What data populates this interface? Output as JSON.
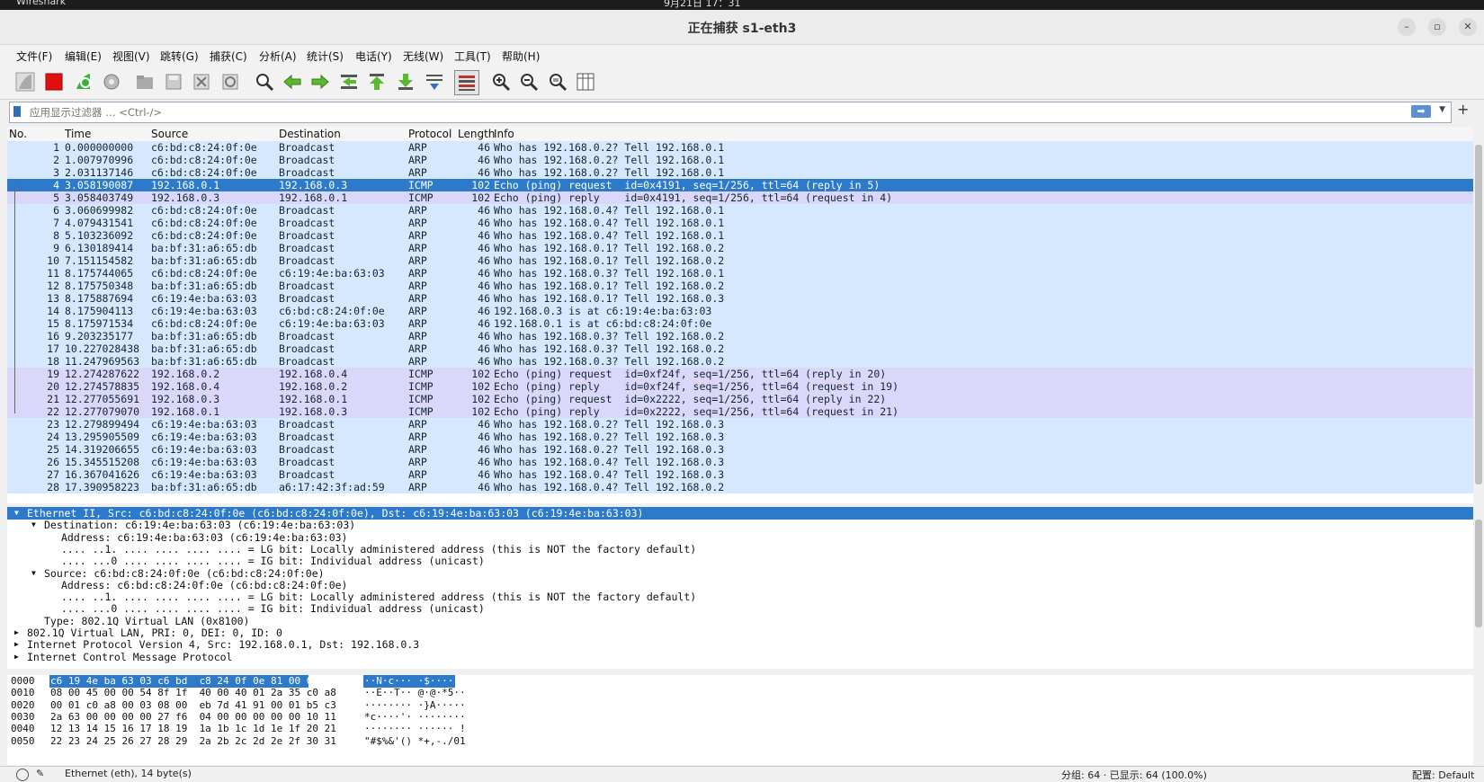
{
  "system": {
    "app_name": "Wireshark",
    "clock": "9月21日 17：31"
  },
  "window": {
    "title": "正在捕获 s1-eth3",
    "minimize": "–",
    "restore": "▫",
    "close": "✕"
  },
  "menu": [
    "文件(F)",
    "编辑(E)",
    "视图(V)",
    "跳转(G)",
    "捕获(C)",
    "分析(A)",
    "统计(S)",
    "电话(Y)",
    "无线(W)",
    "工具(T)",
    "帮助(H)"
  ],
  "toolbar_icons": [
    "shark-fin-start-icon",
    "stop-capture-icon",
    "restart-capture-icon",
    "capture-options-icon",
    "open-file-icon",
    "save-file-icon",
    "close-file-icon",
    "reload-file-icon",
    "find-packet-icon",
    "go-back-icon",
    "go-forward-icon",
    "go-to-packet-icon",
    "go-first-icon",
    "go-last-icon",
    "auto-scroll-icon",
    "colorize-icon",
    "zoom-in-icon",
    "zoom-out-icon",
    "normal-size-icon",
    "resize-columns-icon"
  ],
  "filter": {
    "placeholder": "应用显示过滤器 … <Ctrl-/>",
    "apply_label": "➡",
    "add_label": "+"
  },
  "packet_list": {
    "columns": [
      "No.",
      "Time",
      "Source",
      "Destination",
      "Protocol",
      "Length",
      "Info"
    ],
    "rows": [
      {
        "no": "1",
        "time": "0.000000000",
        "src": "c6:bd:c8:24:0f:0e",
        "dst": "Broadcast",
        "proto": "ARP",
        "len": "46",
        "info": "Who has 192.168.0.2? Tell 192.168.0.1",
        "type": "arp"
      },
      {
        "no": "2",
        "time": "1.007970996",
        "src": "c6:bd:c8:24:0f:0e",
        "dst": "Broadcast",
        "proto": "ARP",
        "len": "46",
        "info": "Who has 192.168.0.2? Tell 192.168.0.1",
        "type": "arp"
      },
      {
        "no": "3",
        "time": "2.031137146",
        "src": "c6:bd:c8:24:0f:0e",
        "dst": "Broadcast",
        "proto": "ARP",
        "len": "46",
        "info": "Who has 192.168.0.2? Tell 192.168.0.1",
        "type": "arp"
      },
      {
        "no": "4",
        "time": "3.058190087",
        "src": "192.168.0.1",
        "dst": "192.168.0.3",
        "proto": "ICMP",
        "len": "102",
        "info": "Echo (ping) request  id=0x4191, seq=1/256, ttl=64 (reply in 5)",
        "type": "sel"
      },
      {
        "no": "5",
        "time": "3.058403749",
        "src": "192.168.0.3",
        "dst": "192.168.0.1",
        "proto": "ICMP",
        "len": "102",
        "info": "Echo (ping) reply    id=0x4191, seq=1/256, ttl=64 (request in 4)",
        "type": "icmp"
      },
      {
        "no": "6",
        "time": "3.060699982",
        "src": "c6:bd:c8:24:0f:0e",
        "dst": "Broadcast",
        "proto": "ARP",
        "len": "46",
        "info": "Who has 192.168.0.4? Tell 192.168.0.1",
        "type": "arp"
      },
      {
        "no": "7",
        "time": "4.079431541",
        "src": "c6:bd:c8:24:0f:0e",
        "dst": "Broadcast",
        "proto": "ARP",
        "len": "46",
        "info": "Who has 192.168.0.4? Tell 192.168.0.1",
        "type": "arp"
      },
      {
        "no": "8",
        "time": "5.103236092",
        "src": "c6:bd:c8:24:0f:0e",
        "dst": "Broadcast",
        "proto": "ARP",
        "len": "46",
        "info": "Who has 192.168.0.4? Tell 192.168.0.1",
        "type": "arp"
      },
      {
        "no": "9",
        "time": "6.130189414",
        "src": "ba:bf:31:a6:65:db",
        "dst": "Broadcast",
        "proto": "ARP",
        "len": "46",
        "info": "Who has 192.168.0.1? Tell 192.168.0.2",
        "type": "arp"
      },
      {
        "no": "10",
        "time": "7.151154582",
        "src": "ba:bf:31:a6:65:db",
        "dst": "Broadcast",
        "proto": "ARP",
        "len": "46",
        "info": "Who has 192.168.0.1? Tell 192.168.0.2",
        "type": "arp"
      },
      {
        "no": "11",
        "time": "8.175744065",
        "src": "c6:bd:c8:24:0f:0e",
        "dst": "c6:19:4e:ba:63:03",
        "proto": "ARP",
        "len": "46",
        "info": "Who has 192.168.0.3? Tell 192.168.0.1",
        "type": "arp"
      },
      {
        "no": "12",
        "time": "8.175750348",
        "src": "ba:bf:31:a6:65:db",
        "dst": "Broadcast",
        "proto": "ARP",
        "len": "46",
        "info": "Who has 192.168.0.1? Tell 192.168.0.2",
        "type": "arp"
      },
      {
        "no": "13",
        "time": "8.175887694",
        "src": "c6:19:4e:ba:63:03",
        "dst": "Broadcast",
        "proto": "ARP",
        "len": "46",
        "info": "Who has 192.168.0.1? Tell 192.168.0.3",
        "type": "arp"
      },
      {
        "no": "14",
        "time": "8.175904113",
        "src": "c6:19:4e:ba:63:03",
        "dst": "c6:bd:c8:24:0f:0e",
        "proto": "ARP",
        "len": "46",
        "info": "192.168.0.3 is at c6:19:4e:ba:63:03",
        "type": "arp"
      },
      {
        "no": "15",
        "time": "8.175971534",
        "src": "c6:bd:c8:24:0f:0e",
        "dst": "c6:19:4e:ba:63:03",
        "proto": "ARP",
        "len": "46",
        "info": "192.168.0.1 is at c6:bd:c8:24:0f:0e",
        "type": "arp"
      },
      {
        "no": "16",
        "time": "9.203235177",
        "src": "ba:bf:31:a6:65:db",
        "dst": "Broadcast",
        "proto": "ARP",
        "len": "46",
        "info": "Who has 192.168.0.3? Tell 192.168.0.2",
        "type": "arp"
      },
      {
        "no": "17",
        "time": "10.227028438",
        "src": "ba:bf:31:a6:65:db",
        "dst": "Broadcast",
        "proto": "ARP",
        "len": "46",
        "info": "Who has 192.168.0.3? Tell 192.168.0.2",
        "type": "arp"
      },
      {
        "no": "18",
        "time": "11.247969563",
        "src": "ba:bf:31:a6:65:db",
        "dst": "Broadcast",
        "proto": "ARP",
        "len": "46",
        "info": "Who has 192.168.0.3? Tell 192.168.0.2",
        "type": "arp"
      },
      {
        "no": "19",
        "time": "12.274287622",
        "src": "192.168.0.2",
        "dst": "192.168.0.4",
        "proto": "ICMP",
        "len": "102",
        "info": "Echo (ping) request  id=0xf24f, seq=1/256, ttl=64 (reply in 20)",
        "type": "icmp"
      },
      {
        "no": "20",
        "time": "12.274578835",
        "src": "192.168.0.4",
        "dst": "192.168.0.2",
        "proto": "ICMP",
        "len": "102",
        "info": "Echo (ping) reply    id=0xf24f, seq=1/256, ttl=64 (request in 19)",
        "type": "icmp"
      },
      {
        "no": "21",
        "time": "12.277055691",
        "src": "192.168.0.3",
        "dst": "192.168.0.1",
        "proto": "ICMP",
        "len": "102",
        "info": "Echo (ping) request  id=0x2222, seq=1/256, ttl=64 (reply in 22)",
        "type": "icmp"
      },
      {
        "no": "22",
        "time": "12.277079070",
        "src": "192.168.0.1",
        "dst": "192.168.0.3",
        "proto": "ICMP",
        "len": "102",
        "info": "Echo (ping) reply    id=0x2222, seq=1/256, ttl=64 (request in 21)",
        "type": "icmp"
      },
      {
        "no": "23",
        "time": "12.279899494",
        "src": "c6:19:4e:ba:63:03",
        "dst": "Broadcast",
        "proto": "ARP",
        "len": "46",
        "info": "Who has 192.168.0.2? Tell 192.168.0.3",
        "type": "arp"
      },
      {
        "no": "24",
        "time": "13.295905509",
        "src": "c6:19:4e:ba:63:03",
        "dst": "Broadcast",
        "proto": "ARP",
        "len": "46",
        "info": "Who has 192.168.0.2? Tell 192.168.0.3",
        "type": "arp"
      },
      {
        "no": "25",
        "time": "14.319206655",
        "src": "c6:19:4e:ba:63:03",
        "dst": "Broadcast",
        "proto": "ARP",
        "len": "46",
        "info": "Who has 192.168.0.2? Tell 192.168.0.3",
        "type": "arp"
      },
      {
        "no": "26",
        "time": "15.345515208",
        "src": "c6:19:4e:ba:63:03",
        "dst": "Broadcast",
        "proto": "ARP",
        "len": "46",
        "info": "Who has 192.168.0.4? Tell 192.168.0.3",
        "type": "arp"
      },
      {
        "no": "27",
        "time": "16.367041626",
        "src": "c6:19:4e:ba:63:03",
        "dst": "Broadcast",
        "proto": "ARP",
        "len": "46",
        "info": "Who has 192.168.0.4? Tell 192.168.0.3",
        "type": "arp"
      },
      {
        "no": "28",
        "time": "17.390958223",
        "src": "ba:bf:31:a6:65:db",
        "dst": "a6:17:42:3f:ad:59",
        "proto": "ARP",
        "len": "46",
        "info": "Who has 192.168.0.4? Tell 192.168.0.2",
        "type": "arp"
      }
    ]
  },
  "details": [
    {
      "text": "Ethernet II, Src: c6:bd:c8:24:0f:0e (c6:bd:c8:24:0f:0e), Dst: c6:19:4e:ba:63:03 (c6:19:4e:ba:63:03)",
      "level": 0,
      "arrow": "expanded",
      "sel": true
    },
    {
      "text": "Destination: c6:19:4e:ba:63:03 (c6:19:4e:ba:63:03)",
      "level": 1,
      "arrow": "expanded",
      "sel": false
    },
    {
      "text": "Address: c6:19:4e:ba:63:03 (c6:19:4e:ba:63:03)",
      "level": 2,
      "arrow": "",
      "sel": false
    },
    {
      "text": ".... ..1. .... .... .... .... = LG bit: Locally administered address (this is NOT the factory default)",
      "level": 2,
      "arrow": "",
      "sel": false
    },
    {
      "text": ".... ...0 .... .... .... .... = IG bit: Individual address (unicast)",
      "level": 2,
      "arrow": "",
      "sel": false
    },
    {
      "text": "Source: c6:bd:c8:24:0f:0e (c6:bd:c8:24:0f:0e)",
      "level": 1,
      "arrow": "expanded",
      "sel": false
    },
    {
      "text": "Address: c6:bd:c8:24:0f:0e (c6:bd:c8:24:0f:0e)",
      "level": 2,
      "arrow": "",
      "sel": false
    },
    {
      "text": ".... ..1. .... .... .... .... = LG bit: Locally administered address (this is NOT the factory default)",
      "level": 2,
      "arrow": "",
      "sel": false
    },
    {
      "text": ".... ...0 .... .... .... .... = IG bit: Individual address (unicast)",
      "level": 2,
      "arrow": "",
      "sel": false
    },
    {
      "text": "Type: 802.1Q Virtual LAN (0x8100)",
      "level": 1,
      "arrow": "",
      "sel": false
    },
    {
      "text": "802.1Q Virtual LAN, PRI: 0, DEI: 0, ID: 0",
      "level": 0,
      "arrow": "collapsed",
      "sel": false
    },
    {
      "text": "Internet Protocol Version 4, Src: 192.168.0.1, Dst: 192.168.0.3",
      "level": 0,
      "arrow": "collapsed",
      "sel": false
    },
    {
      "text": "Internet Control Message Protocol",
      "level": 0,
      "arrow": "collapsed",
      "sel": false
    }
  ],
  "hex": [
    {
      "offset": "0000",
      "bytes": "c6 19 4e ba 63 03 c6 bd  c8 24 0f 0e 81 00 00 00",
      "ascii": "··N·c··· ·$······"
    },
    {
      "offset": "0010",
      "bytes": "08 00 45 00 00 54 8f 1f  40 00 40 01 2a 35 c0 a8",
      "ascii": "··E··T·· @·@·*5··"
    },
    {
      "offset": "0020",
      "bytes": "00 01 c0 a8 00 03 08 00  eb 7d 41 91 00 01 b5 c3",
      "ascii": "········ ·}A·····"
    },
    {
      "offset": "0030",
      "bytes": "2a 63 00 00 00 00 27 f6  04 00 00 00 00 00 10 11",
      "ascii": "*c····'· ········"
    },
    {
      "offset": "0040",
      "bytes": "12 13 14 15 16 17 18 19  1a 1b 1c 1d 1e 1f 20 21",
      "ascii": "········ ······ !"
    },
    {
      "offset": "0050",
      "bytes": "22 23 24 25 26 27 28 29  2a 2b 2c 2d 2e 2f 30 31",
      "ascii": "\"#$%&'() *+,-./01"
    }
  ],
  "status": {
    "field": "Ethernet (eth), 14 byte(s)",
    "packets": "分组: 64 · 已显示: 64 (100.0%)",
    "profile": "配置: Default"
  },
  "colors": {
    "arp_row": "#d6e8ff",
    "icmp_row": "#dad7fb",
    "selected": "#2c7ac9"
  }
}
